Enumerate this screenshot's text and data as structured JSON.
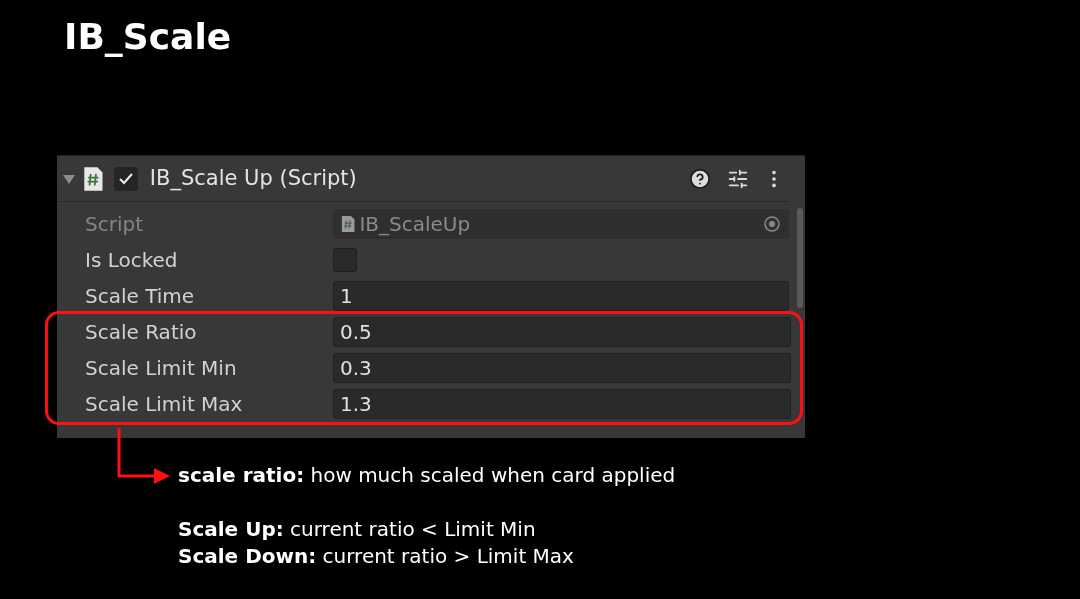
{
  "title": "IB_Scale",
  "component": {
    "name": "IB_Scale Up (Script)",
    "expanded": true,
    "enabled": true
  },
  "properties": [
    {
      "kind": "object",
      "label": "Script",
      "value": "IB_ScaleUp",
      "disabled": true
    },
    {
      "kind": "checkbox",
      "label": "Is Locked",
      "checked": false,
      "disabled": false
    },
    {
      "kind": "text",
      "label": "Scale Time",
      "value": "1",
      "disabled": false
    }
  ],
  "highlighted_properties": [
    {
      "kind": "text",
      "label": "Scale Ratio",
      "value": "0.5",
      "disabled": false
    },
    {
      "kind": "text",
      "label": "Scale Limit Min",
      "value": "0.3",
      "disabled": false
    },
    {
      "kind": "text",
      "label": "Scale Limit Max",
      "value": "1.3",
      "disabled": false
    }
  ],
  "notes": [
    {
      "text": "**scale ratio:** how much scaled when card applied"
    },
    {
      "text": "**Scale Up:** current ratio < Limit Min"
    },
    {
      "text": "**Scale Down:** current ratio > Limit Max"
    }
  ]
}
